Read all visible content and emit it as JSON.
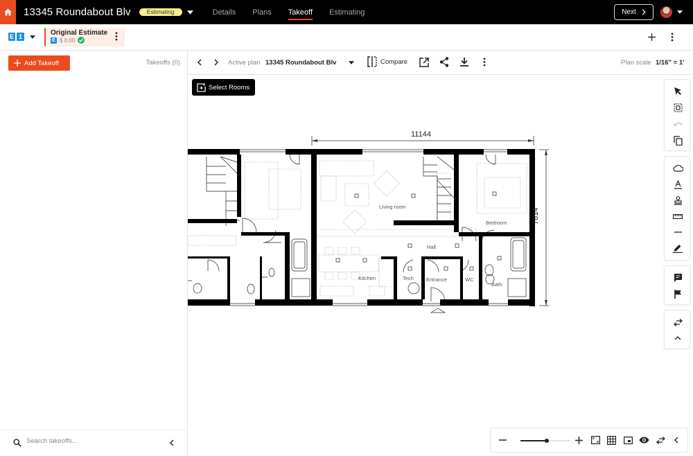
{
  "header": {
    "project_title": "13345 Roundabout Blv",
    "status": "Estimating",
    "tabs": [
      {
        "label": "Details",
        "active": false
      },
      {
        "label": "Plans",
        "active": false
      },
      {
        "label": "Takeoff",
        "active": true
      },
      {
        "label": "Estimating",
        "active": false
      }
    ],
    "next_label": "Next",
    "accent_color": "#ea4b1f",
    "status_color": "#f6ee8c"
  },
  "estimate_bar": {
    "version_badges": [
      "E",
      "1"
    ],
    "estimate_name": "Original Estimate",
    "estimate_badge": "E",
    "estimate_amount": "$ 0.00"
  },
  "left_panel": {
    "add_takeoff_label": "Add Takeoff",
    "takeoffs_count": "Takeoffs (0)",
    "search_placeholder": "Search takeoffs..."
  },
  "plan_toolbar": {
    "active_plan_label": "Active plan",
    "active_plan_value": "13345 Roundabout Blv",
    "compare_label": "Compare",
    "plan_scale_label": "Plan scale",
    "plan_scale_value": "1/16\" = 1'"
  },
  "canvas": {
    "select_rooms_label": "Select Rooms",
    "plan": {
      "dimension_width": "11144",
      "dimension_height": "7814",
      "rooms": [
        "Living room",
        "Bedroom",
        "Hall",
        "Kitchen",
        "Tech",
        "Entrance",
        "WC",
        "Bath"
      ]
    }
  },
  "right_toolbar": {
    "groups": [
      [
        "select-pointer-icon",
        "area-select-icon",
        "undo-icon",
        "copy-icon"
      ],
      [
        "cloud-icon",
        "text-icon",
        "stamp-icon",
        "ruler-icon",
        "line-icon",
        "pen-icon"
      ],
      [
        "comment-icon",
        "flag-icon"
      ],
      [
        "swap-icon",
        "chevron-up-icon"
      ]
    ]
  },
  "zoom_bar": {
    "zoom_level_fraction": 0.52
  }
}
